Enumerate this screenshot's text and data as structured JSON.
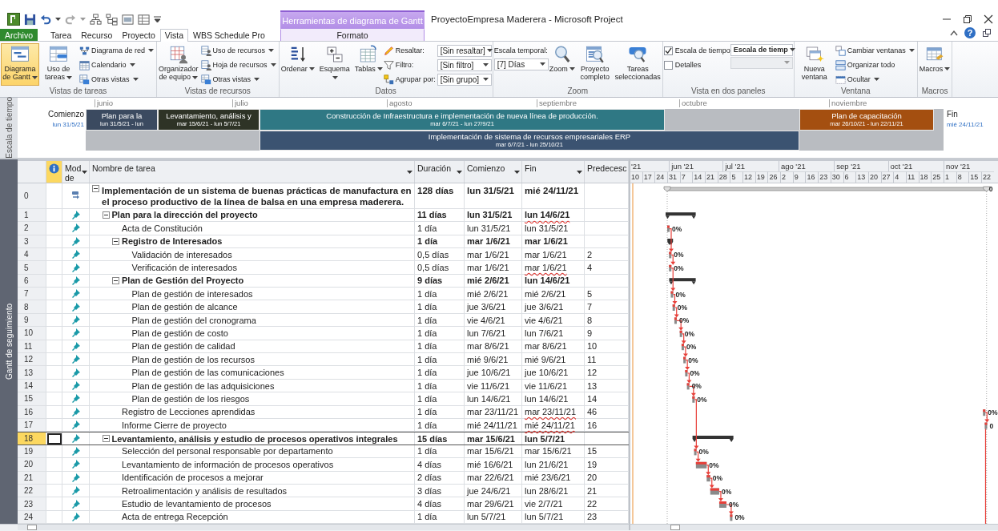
{
  "window": {
    "title": "ProyectoEmpresa Maderera  -  Microsoft Project",
    "help": "?"
  },
  "contextual_tab": {
    "title": "Herramientas de diagrama de Gantt"
  },
  "tabs": [
    {
      "label": "Archivo",
      "kind": "file",
      "selected": false
    },
    {
      "label": "Tarea",
      "kind": "tab",
      "selected": false
    },
    {
      "label": "Recurso",
      "kind": "tab",
      "selected": false
    },
    {
      "label": "Proyecto",
      "kind": "tab",
      "selected": false
    },
    {
      "label": "Vista",
      "kind": "tab",
      "selected": true
    },
    {
      "label": "WBS Schedule Pro",
      "kind": "tab",
      "selected": false
    },
    {
      "label": "Formato",
      "kind": "contextual",
      "selected": false
    }
  ],
  "ribbon": {
    "groups": [
      {
        "label": "Vistas de tareas",
        "items": [
          {
            "kind": "large",
            "label": "Diagrama de Gantt",
            "dropdown": true,
            "selected": true
          },
          {
            "kind": "large",
            "label": "Uso de tareas",
            "dropdown": true,
            "selected": false
          },
          {
            "kind": "stack",
            "items": [
              {
                "kind": "small",
                "label": "Diagrama de red",
                "dropdown": true
              },
              {
                "kind": "small",
                "label": "Calendario",
                "dropdown": true
              },
              {
                "kind": "small",
                "label": "Otras vistas",
                "dropdown": true
              }
            ]
          }
        ]
      },
      {
        "label": "Vistas de recursos",
        "items": [
          {
            "kind": "large",
            "label": "Organizador de equipo",
            "dropdown": true,
            "selected": false
          },
          {
            "kind": "stack",
            "items": [
              {
                "kind": "small",
                "label": "Uso de recursos",
                "dropdown": true
              },
              {
                "kind": "small",
                "label": "Hoja de recursos",
                "dropdown": true
              },
              {
                "kind": "small",
                "label": "Otras vistas",
                "dropdown": true
              }
            ]
          }
        ]
      },
      {
        "label": "Datos",
        "items": [
          {
            "kind": "large",
            "label": "Ordenar",
            "dropdown": true,
            "selected": false
          },
          {
            "kind": "large",
            "label": "Esquema",
            "dropdown": true,
            "selected": false
          },
          {
            "kind": "large",
            "label": "Tablas",
            "dropdown": true,
            "selected": false
          },
          {
            "kind": "stack",
            "items": [
              {
                "kind": "field",
                "label": "Resaltar:",
                "value": "[Sin resaltar]"
              },
              {
                "kind": "field",
                "label": "Filtro:",
                "value": "[Sin filtro]"
              },
              {
                "kind": "field",
                "label": "Agrupar por:",
                "value": "[Sin grupo]"
              }
            ]
          }
        ]
      },
      {
        "label": "Zoom",
        "items": [
          {
            "kind": "stack",
            "items": [
              {
                "kind": "caption",
                "label": "Escala temporal:"
              },
              {
                "kind": "combo",
                "value": "[7] Días",
                "disabled": false
              }
            ]
          },
          {
            "kind": "large",
            "label": "Zoom",
            "dropdown": true,
            "selected": false
          },
          {
            "kind": "large",
            "label": "Proyecto completo",
            "dropdown": false,
            "selected": false
          },
          {
            "kind": "large",
            "label": "Tareas seleccionadas",
            "dropdown": false,
            "selected": false
          }
        ]
      },
      {
        "label": "Vista en dos paneles",
        "items": [
          {
            "kind": "stack",
            "items": [
              {
                "kind": "check",
                "label": "Escala de tiempo",
                "checked": true
              },
              {
                "kind": "check",
                "label": "Detalles",
                "checked": false
              }
            ]
          },
          {
            "kind": "stack",
            "items": [
              {
                "kind": "combo",
                "value": "Escala de tiemp",
                "disabled": false
              },
              {
                "kind": "combo",
                "disabled": true
              }
            ]
          }
        ]
      },
      {
        "label": "Ventana",
        "items": [
          {
            "kind": "large",
            "label": "Nueva ventana",
            "dropdown": false,
            "selected": false
          },
          {
            "kind": "stack",
            "items": [
              {
                "kind": "small",
                "label": "Cambiar ventanas",
                "dropdown": true
              },
              {
                "kind": "small",
                "label": "Organizar todo",
                "dropdown": false
              },
              {
                "kind": "small",
                "label": "Ocultar",
                "dropdown": true
              }
            ]
          }
        ]
      },
      {
        "label": "Macros",
        "items": [
          {
            "kind": "large",
            "label": "Macros",
            "dropdown": true,
            "selected": false
          }
        ]
      }
    ]
  },
  "timeline": {
    "label": "Escala de tiempo",
    "start_label": "Comienzo",
    "start_date": "lun 31/5/21",
    "end_label": "Fin",
    "end_date": "mié 24/11/21",
    "months": [
      "junio",
      "julio",
      "agosto",
      "septiembre",
      "octubre",
      "noviembre"
    ],
    "bars": [
      {
        "title": "Plan para la",
        "dates": "lun 31/5/21 - lun",
        "color": "#3b4a60"
      },
      {
        "title": "Levantamiento, análisis y",
        "dates": "mar 15/6/21 - lun 5/7/21",
        "color": "#2e3326"
      },
      {
        "title": "Construcción de Infraestructura e implementación de nueva línea de producción.",
        "dates": "mar 6/7/21 - lun 27/9/21",
        "color": "#2f7884"
      },
      {
        "title": "Plan de capacitación",
        "dates": "mar 26/10/21 - lun 22/11/21",
        "color": "#a44f10"
      },
      {
        "title": "Implementación de sistema de recursos empresariales ERP",
        "dates": "mar 6/7/21 - lun 25/10/21",
        "color": "#3b5371"
      }
    ]
  },
  "view": {
    "label": "Gantt de seguimiento"
  },
  "table": {
    "columns": [
      "Mod de",
      "Nombre de tarea",
      "Duración",
      "Comienzo",
      "Fin",
      "Predecesc"
    ]
  },
  "gantt": {
    "months": [
      "'21",
      "jun '21",
      "jul '21",
      "ago '21",
      "sep '21",
      "oct '21",
      "nov '21"
    ],
    "weeks": [
      "10",
      "17",
      "24",
      "31",
      "7",
      "14",
      "21",
      "28",
      "5",
      "12",
      "19",
      "26",
      "2",
      "9",
      "16",
      "23",
      "30",
      "6",
      "13",
      "20",
      "27",
      "4",
      "11",
      "18",
      "25",
      "1",
      "8",
      "15",
      "22"
    ]
  },
  "tasks": [
    {
      "id": "0",
      "kind": "project",
      "name": "Implementación de un sistema de buenas prácticas de manufactura en el proceso productivo de la línea de balsa en una empresa maderera.",
      "duration": "128 días",
      "start": "lun 31/5/21",
      "finish": "mié 24/11/21",
      "selected": false,
      "finish_flagged": false,
      "expanded": true,
      "bar_label": "0",
      "children": [
        {
          "id": "1",
          "kind": "summary",
          "name": "Plan para la dirección del proyecto",
          "duration": "11 días",
          "start": "lun 31/5/21",
          "finish": "lun 14/6/21",
          "selected": false,
          "finish_flagged": true,
          "expanded": true,
          "children": [
            {
              "id": "2",
              "kind": "task",
              "name": "Acta de Constitución",
              "duration": "1 día",
              "start": "lun 31/5/21",
              "finish": "lun 31/5/21",
              "selected": false,
              "finish_flagged": false,
              "bar_label": "0%"
            },
            {
              "id": "3",
              "kind": "summary",
              "name": "Registro de Interesados",
              "duration": "1 día",
              "start": "mar 1/6/21",
              "finish": "mar 1/6/21",
              "selected": false,
              "finish_flagged": false,
              "expanded": true,
              "children": [
                {
                  "id": "4",
                  "kind": "task",
                  "name": "Validación de interesados",
                  "duration": "0,5 días",
                  "start": "mar 1/6/21",
                  "finish": "mar 1/6/21",
                  "predecessors": "2",
                  "selected": false,
                  "finish_flagged": false,
                  "bar_label": "0%"
                },
                {
                  "id": "5",
                  "kind": "task",
                  "name": "Verificación de interesados",
                  "duration": "0,5 días",
                  "start": "mar 1/6/21",
                  "finish": "mar 1/6/21",
                  "predecessors": "4",
                  "selected": false,
                  "finish_flagged": true,
                  "bar_label": "0%"
                }
              ]
            },
            {
              "id": "6",
              "kind": "summary",
              "name": "Plan de Gestión del Proyecto",
              "duration": "9 días",
              "start": "mié 2/6/21",
              "finish": "lun 14/6/21",
              "selected": false,
              "finish_flagged": false,
              "expanded": true,
              "children": [
                {
                  "id": "7",
                  "kind": "task",
                  "name": "Plan de gestión de interesados",
                  "duration": "1 día",
                  "start": "mié 2/6/21",
                  "finish": "mié 2/6/21",
                  "predecessors": "5",
                  "selected": false,
                  "finish_flagged": false,
                  "bar_label": "0%"
                },
                {
                  "id": "8",
                  "kind": "task",
                  "name": "Plan de gestión de alcance",
                  "duration": "1 día",
                  "start": "jue 3/6/21",
                  "finish": "jue 3/6/21",
                  "predecessors": "7",
                  "selected": false,
                  "finish_flagged": false,
                  "bar_label": "0%"
                },
                {
                  "id": "9",
                  "kind": "task",
                  "name": "Plan de gestión del cronograma",
                  "duration": "1 día",
                  "start": "vie 4/6/21",
                  "finish": "vie 4/6/21",
                  "predecessors": "8",
                  "selected": false,
                  "finish_flagged": false,
                  "bar_label": "0%"
                },
                {
                  "id": "10",
                  "kind": "task",
                  "name": "Plan de gestión de costo",
                  "duration": "1 día",
                  "start": "lun 7/6/21",
                  "finish": "lun 7/6/21",
                  "predecessors": "9",
                  "selected": false,
                  "finish_flagged": false,
                  "bar_label": "0%"
                },
                {
                  "id": "11",
                  "kind": "task",
                  "name": "Plan de gestión de calidad",
                  "duration": "1 día",
                  "start": "mar 8/6/21",
                  "finish": "mar 8/6/21",
                  "predecessors": "10",
                  "selected": false,
                  "finish_flagged": false,
                  "bar_label": "0%"
                },
                {
                  "id": "12",
                  "kind": "task",
                  "name": "Plan de gestión de los recursos",
                  "duration": "1 día",
                  "start": "mié 9/6/21",
                  "finish": "mié 9/6/21",
                  "predecessors": "11",
                  "selected": false,
                  "finish_flagged": false,
                  "bar_label": "0%"
                },
                {
                  "id": "13",
                  "kind": "task",
                  "name": "Plan de gestión de las comunicaciones",
                  "duration": "1 día",
                  "start": "jue 10/6/21",
                  "finish": "jue 10/6/21",
                  "predecessors": "12",
                  "selected": false,
                  "finish_flagged": false,
                  "bar_label": "0%"
                },
                {
                  "id": "14",
                  "kind": "task",
                  "name": "Plan de gestión de las adquisiciones",
                  "duration": "1 día",
                  "start": "vie 11/6/21",
                  "finish": "vie 11/6/21",
                  "predecessors": "13",
                  "selected": false,
                  "finish_flagged": false,
                  "bar_label": "0%"
                },
                {
                  "id": "15",
                  "kind": "task",
                  "name": "Plan de gestión de los riesgos",
                  "duration": "1 día",
                  "start": "lun 14/6/21",
                  "finish": "lun 14/6/21",
                  "predecessors": "14",
                  "selected": false,
                  "finish_flagged": false,
                  "bar_label": "0%"
                }
              ]
            },
            {
              "id": "16",
              "kind": "task",
              "name": "Registro de Lecciones aprendidas",
              "duration": "1 día",
              "start": "mar 23/11/21",
              "finish": "mar 23/11/21",
              "predecessors": "46",
              "selected": false,
              "finish_flagged": true,
              "bar_label": "0%"
            },
            {
              "id": "17",
              "kind": "task",
              "name": "Informe Cierre de proyecto",
              "duration": "1 día",
              "start": "mié 24/11/21",
              "finish": "mié 24/11/21",
              "predecessors": "16",
              "selected": false,
              "finish_flagged": true,
              "bar_label": "0"
            }
          ]
        },
        {
          "id": "18",
          "kind": "summary",
          "name": "Levantamiento, análisis y estudio de procesos operativos integrales",
          "duration": "15 días",
          "start": "mar 15/6/21",
          "finish": "lun 5/7/21",
          "selected": true,
          "finish_flagged": false,
          "expanded": true,
          "children": [
            {
              "id": "19",
              "kind": "task",
              "name": "Selección del personal responsable por departamento",
              "duration": "1 día",
              "start": "mar 15/6/21",
              "finish": "mar 15/6/21",
              "predecessors": "15",
              "selected": false,
              "finish_flagged": false,
              "bar_label": "0%"
            },
            {
              "id": "20",
              "kind": "task",
              "name": "Levantamiento de información de procesos operativos",
              "duration": "4 días",
              "start": "mié 16/6/21",
              "finish": "lun 21/6/21",
              "predecessors": "19",
              "selected": false,
              "finish_flagged": false,
              "bar_label": "0%"
            },
            {
              "id": "21",
              "kind": "task",
              "name": "Identificación de procesos a mejorar",
              "duration": "2 días",
              "start": "mar 22/6/21",
              "finish": "mié 23/6/21",
              "predecessors": "20",
              "selected": false,
              "finish_flagged": false,
              "bar_label": "0%"
            },
            {
              "id": "22",
              "kind": "task",
              "name": "Retroalimentación y análisis de resultados",
              "duration": "3 días",
              "start": "jue 24/6/21",
              "finish": "lun 28/6/21",
              "predecessors": "21",
              "selected": false,
              "finish_flagged": false,
              "bar_label": "0%"
            },
            {
              "id": "23",
              "kind": "task",
              "name": "Estudio de levantamiento de procesos",
              "duration": "4 días",
              "start": "mar 29/6/21",
              "finish": "vie 2/7/21",
              "predecessors": "22",
              "selected": false,
              "finish_flagged": false,
              "bar_label": "0%"
            },
            {
              "id": "24",
              "kind": "task",
              "name": "Acta de entrega Recepción",
              "duration": "1 día",
              "start": "lun 5/7/21",
              "finish": "lun 5/7/21",
              "predecessors": "23",
              "selected": false,
              "finish_flagged": false,
              "bar_label": "0%"
            }
          ]
        }
      ]
    }
  ]
}
